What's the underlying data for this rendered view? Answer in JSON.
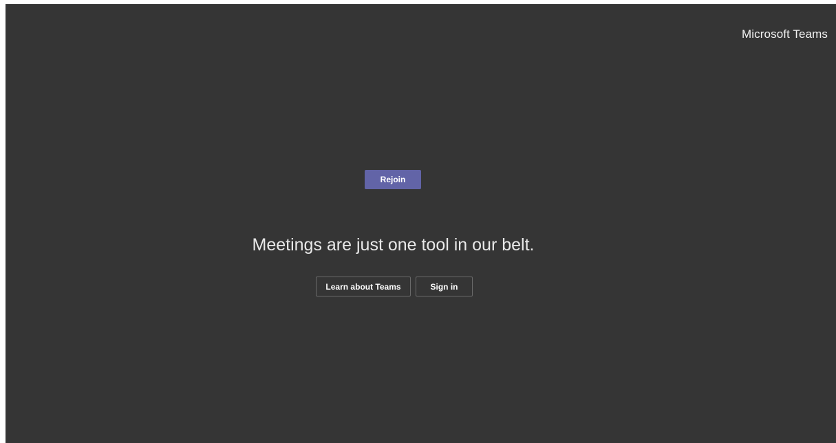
{
  "header": {
    "brand": "Microsoft Teams"
  },
  "main": {
    "rejoin_label": "Rejoin",
    "tagline": "Meetings are just one tool in our belt.",
    "learn_label": "Learn about Teams",
    "signin_label": "Sign in"
  },
  "colors": {
    "background": "#353535",
    "accent": "#6264a7"
  }
}
